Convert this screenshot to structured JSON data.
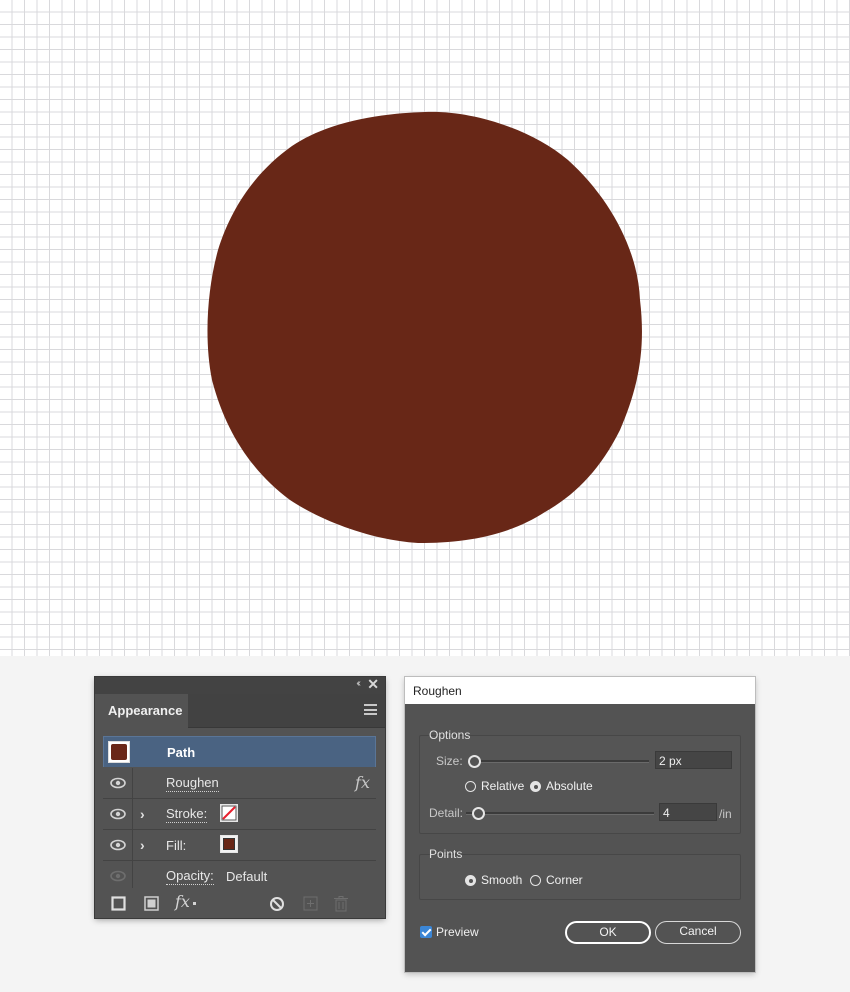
{
  "canvas": {
    "grid_color": "#d9d9dc",
    "background": "#ffffff",
    "shape_fill": "#682717"
  },
  "appearance_panel": {
    "tab_label": "Appearance",
    "collapse_glyph": "‹‹",
    "close_glyph": "✕",
    "path_label": "Path",
    "rows": {
      "roughen_label": "Roughen",
      "fx_glyph": "fx",
      "stroke_label": "Stroke:",
      "fill_label": "Fill:",
      "opacity_label": "Opacity:",
      "opacity_value": "Default"
    },
    "chevron_glyph": "›",
    "footer_fx_glyph": "fx",
    "highlight_color": "#4a6382"
  },
  "roughen_dialog": {
    "title": "Roughen",
    "options_group_title": "Options",
    "size_label": "Size:",
    "size_value": "2 px",
    "relative_label": "Relative",
    "absolute_label": "Absolute",
    "detail_label": "Detail:",
    "detail_value": "4",
    "detail_unit": "/in",
    "points_group_title": "Points",
    "smooth_label": "Smooth",
    "corner_label": "Corner",
    "preview_label": "Preview",
    "ok_label": "OK",
    "cancel_label": "Cancel",
    "preview_checked": true,
    "size_selected": "Absolute",
    "points_selected": "Smooth"
  }
}
